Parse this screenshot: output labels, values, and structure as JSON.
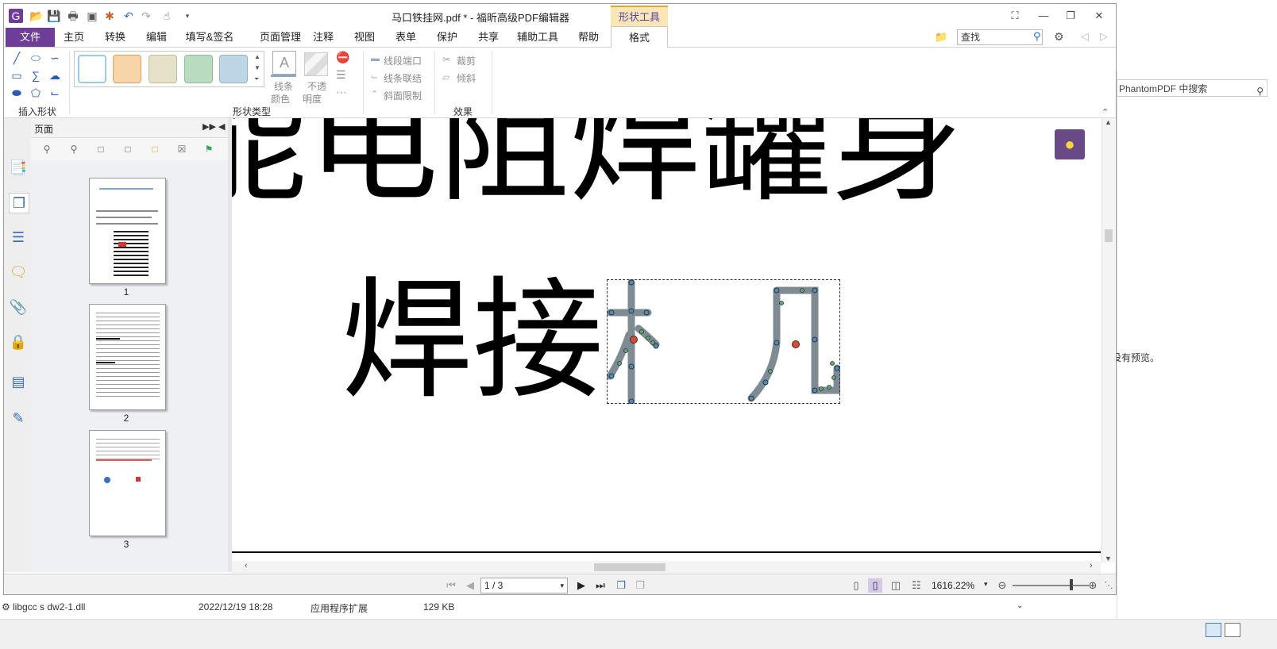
{
  "window_title": "马口铁挂网.pdf * - 福昕高级PDF编辑器",
  "context_tab_header": "形状工具",
  "menu_tabs": {
    "file": "文件",
    "home": "主页",
    "convert": "转换",
    "edit": "编辑",
    "fill_sign": "填写&签名",
    "page_manage": "页面管理",
    "comment": "注释",
    "view": "视图",
    "form": "表单",
    "protect": "保护",
    "share": "共享",
    "accessibility": "辅助工具",
    "help": "帮助",
    "format": "格式"
  },
  "search_placeholder": "查找",
  "ribbon": {
    "insert_shape_label": "插入形状",
    "shape_type_label": "形状类型",
    "effects_label": "效果",
    "line_color_1": "线条",
    "line_color_2": "颜色",
    "opacity_1": "不透",
    "opacity_2": "明度",
    "line_cap": "线段端口",
    "line_join": "线条联结",
    "miter_limit": "斜面限制",
    "crop": "裁剪",
    "skew": "倾斜",
    "swatch_colors": [
      "#ffffff",
      "#f8d5a8",
      "#e6e2c8",
      "#b9dcc0",
      "#bdd6e6"
    ]
  },
  "pages_panel": {
    "title": "页面",
    "page_numbers": [
      "1",
      "2",
      "3"
    ]
  },
  "document": {
    "line1": "能电阻焊罐身",
    "line2": "焊接"
  },
  "statusbar": {
    "page_indicator": "1 / 3",
    "zoom": "1616.22%"
  },
  "background": {
    "search_hint": "PhantomPDF 中搜索",
    "no_preview": "没有预览。",
    "file_name": "libgcc s dw2-1.dll",
    "file_date": "2022/12/19 18:28",
    "file_type": "应用程序扩展",
    "file_size": "129 KB"
  },
  "colors": {
    "file_tab": "#6e3d97",
    "context_tab": "#fbe6b6",
    "bulb_button": "#6a4a86",
    "accent_blue": "#2a6fc9"
  }
}
